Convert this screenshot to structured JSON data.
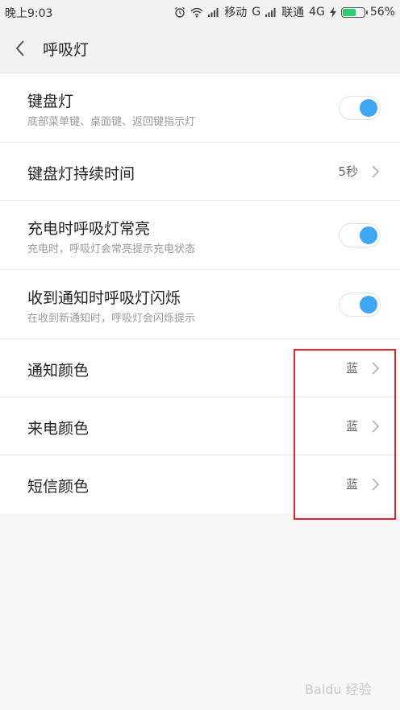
{
  "status_bar": {
    "time": "晚上9:03",
    "carrier1": "移动",
    "network1": "G",
    "carrier2": "联通",
    "network2": "4G",
    "battery": "56%",
    "battery_level": 0.56
  },
  "header": {
    "title": "呼吸灯"
  },
  "settings": [
    {
      "title": "键盘灯",
      "subtitle": "底部菜单键、桌面键、返回键指示灯",
      "toggle_on": true
    },
    {
      "title": "键盘灯持续时间",
      "value": "5秒"
    },
    {
      "title": "充电时呼吸灯常亮",
      "subtitle": "充电时，呼吸灯会常亮提示充电状态",
      "toggle_on": true
    },
    {
      "title": "收到通知时呼吸灯闪烁",
      "subtitle": "在收到新通知时，呼吸灯会闪烁提示",
      "toggle_on": true
    },
    {
      "title": "通知颜色",
      "value": "蓝"
    },
    {
      "title": "来电颜色",
      "value": "蓝"
    },
    {
      "title": "短信颜色",
      "value": "蓝"
    }
  ],
  "watermark": "Baidu 经验",
  "colors": {
    "toggle_accent": "#3ea7f2",
    "highlight": "#e3262c"
  }
}
